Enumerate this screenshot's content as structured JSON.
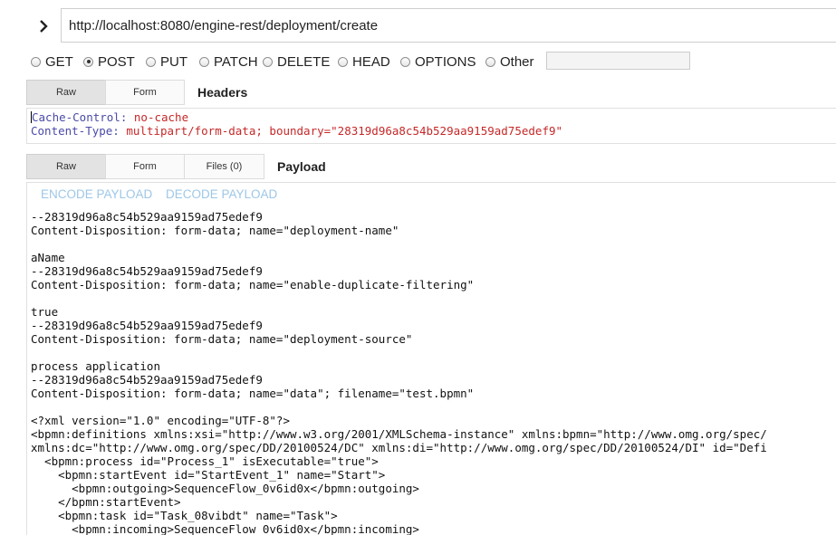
{
  "request": {
    "url": "http://localhost:8080/engine-rest/deployment/create",
    "methods": [
      {
        "label": "GET",
        "checked": false
      },
      {
        "label": "POST",
        "checked": true
      },
      {
        "label": "PUT",
        "checked": false
      },
      {
        "label": "PATCH",
        "checked": false
      },
      {
        "label": "DELETE",
        "checked": false
      },
      {
        "label": "HEAD",
        "checked": false
      },
      {
        "label": "OPTIONS",
        "checked": false
      },
      {
        "label": "Other",
        "checked": false
      }
    ],
    "other_method_value": ""
  },
  "headers": {
    "tabs": {
      "raw": "Raw",
      "form": "Form"
    },
    "title": "Headers",
    "lines": [
      {
        "key": "Cache-Control:",
        "value": "no-cache"
      },
      {
        "key": "Content-Type:",
        "value": "multipart/form-data; boundary=\"28319d96a8c54b529aa9159ad75edef9\""
      }
    ]
  },
  "payload": {
    "tabs": {
      "raw": "Raw",
      "form": "Form",
      "files": "Files (0)"
    },
    "title": "Payload",
    "actions": {
      "encode": "ENCODE PAYLOAD",
      "decode": "DECODE PAYLOAD"
    },
    "body": "--28319d96a8c54b529aa9159ad75edef9\nContent-Disposition: form-data; name=\"deployment-name\"\n\naName\n--28319d96a8c54b529aa9159ad75edef9\nContent-Disposition: form-data; name=\"enable-duplicate-filtering\"\n\ntrue\n--28319d96a8c54b529aa9159ad75edef9\nContent-Disposition: form-data; name=\"deployment-source\"\n\nprocess application\n--28319d96a8c54b529aa9159ad75edef9\nContent-Disposition: form-data; name=\"data\"; filename=\"test.bpmn\"\n\n<?xml version=\"1.0\" encoding=\"UTF-8\"?>\n<bpmn:definitions xmlns:xsi=\"http://www.w3.org/2001/XMLSchema-instance\" xmlns:bpmn=\"http://www.omg.org/spec/\nxmlns:dc=\"http://www.omg.org/spec/DD/20100524/DC\" xmlns:di=\"http://www.omg.org/spec/DD/20100524/DI\" id=\"Defi\n  <bpmn:process id=\"Process_1\" isExecutable=\"true\">\n    <bpmn:startEvent id=\"StartEvent_1\" name=\"Start\">\n      <bpmn:outgoing>SequenceFlow_0v6id0x</bpmn:outgoing>\n    </bpmn:startEvent>\n    <bpmn:task id=\"Task_08vibdt\" name=\"Task\">\n      <bpmn:incoming>SequenceFlow_0v6id0x</bpmn:incoming>"
  }
}
